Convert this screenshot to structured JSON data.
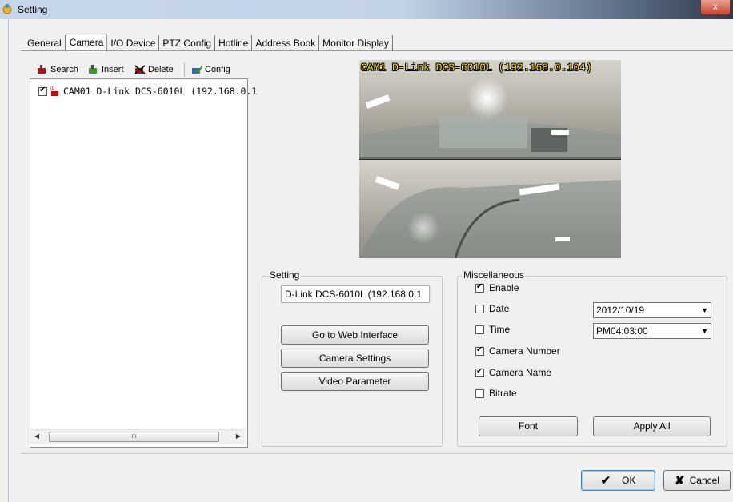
{
  "window": {
    "title": "Setting",
    "close_glyph": "x"
  },
  "tabs": [
    {
      "label": "General",
      "active": false
    },
    {
      "label": "Camera",
      "active": true
    },
    {
      "label": "I/O Device",
      "active": false
    },
    {
      "label": "PTZ Config",
      "active": false
    },
    {
      "label": "Hotline",
      "active": false
    },
    {
      "label": "Address Book",
      "active": false
    },
    {
      "label": "Monitor Display",
      "active": false
    }
  ],
  "toolbar": {
    "search_label": "Search",
    "insert_label": "Insert",
    "delete_label": "Delete",
    "config_label": "Config"
  },
  "tree": {
    "items": [
      {
        "label": "CAM01 D-Link DCS-6010L (192.168.0.1",
        "checked": true,
        "badge": "IP"
      }
    ],
    "scroll_thumb_glyph": "III"
  },
  "camera_view": {
    "overlay": "CAM1 D-Link DCS-6010L (192.168.0.104)"
  },
  "setting_group": {
    "label": "Setting",
    "name_value": "D-Link DCS-6010L (192.168.0.1",
    "web_button": "Go to Web Interface",
    "camera_settings_button": "Camera Settings",
    "video_param_button": "Video Parameter"
  },
  "misc_group": {
    "label": "Miscellaneous",
    "enable": {
      "label": "Enable",
      "checked": true
    },
    "date": {
      "label": "Date",
      "checked": false,
      "value": "2012/10/19"
    },
    "time": {
      "label": "Time",
      "checked": false,
      "value": "PM04:03:00"
    },
    "camera_number": {
      "label": "Camera Number",
      "checked": true
    },
    "camera_name": {
      "label": "Camera Name",
      "checked": true
    },
    "bitrate": {
      "label": "Bitrate",
      "checked": false
    },
    "font_button": "Font",
    "apply_all_button": "Apply All"
  },
  "footer": {
    "ok_label": "OK",
    "cancel_label": "Cancel"
  },
  "colors": {
    "overlay_text": "#ffd800",
    "titlebar": "#c7d7ea",
    "close_button": "#c7442e"
  }
}
